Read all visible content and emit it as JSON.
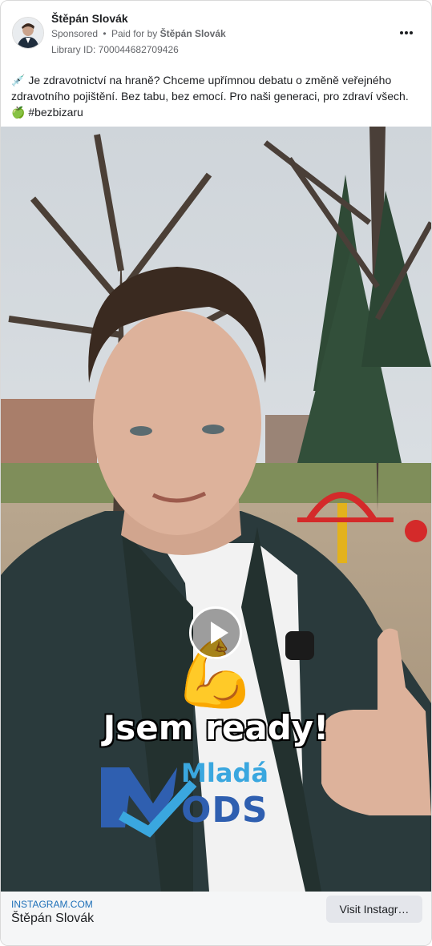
{
  "post": {
    "page_name": "Štěpán Slovák",
    "sponsored": "Sponsored",
    "paid_for_by_prefix": "Paid for by",
    "paid_for_by": "Štěpán Slovák",
    "library_id": "Library ID: 700044682709426",
    "caption": "💉 Je zdravotnictví na hraně? Chceme upřímnou debatu o změně veřejného zdravotního pojištění. Bez tabu, bez emocí. Pro naši generaci, pro zdraví všech. 🍏 #bezbizaru"
  },
  "media": {
    "overlay_text": "Jsem ready!",
    "logo_top": "Mladá",
    "logo_bottom": "ODS",
    "emoji": "💪"
  },
  "footer": {
    "domain": "INSTAGRAM.COM",
    "title": "Štěpán Slovák",
    "cta": "Visit Instagr…"
  },
  "colors": {
    "link_blue": "#1d6fb8",
    "logo_blue": "#2f5fb0",
    "logo_light": "#3aa7df",
    "footer_bg": "#f5f6f7",
    "button_bg": "#e4e6eb"
  },
  "icons": {
    "more": "more-dots-icon",
    "play": "play-icon"
  }
}
